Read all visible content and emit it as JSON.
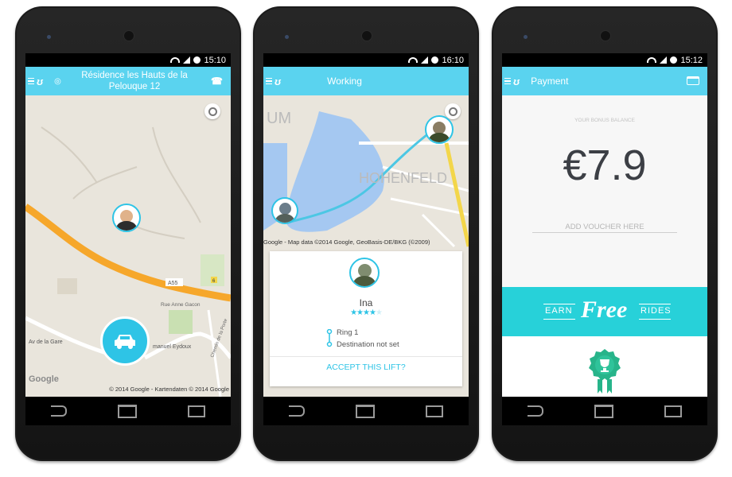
{
  "phones": [
    {
      "status_time": "15:10",
      "header_title": "Résidence les Hauts de la Pelouque 12",
      "map_copyright": "© 2014 Google - Kartendaten © 2014 Google",
      "map_logo": "Google",
      "road_label": "A55",
      "road_number": "6",
      "street_labels": [
        "Rue Anne Gacon",
        "Av de la Gare",
        "manuel Eydoux",
        "Chemin de la Porte"
      ]
    },
    {
      "status_time": "16:10",
      "header_title": "Working",
      "map_copyright": "Google - Map data ©2014 Google, GeoBasis-DE/BKG (©2009)",
      "map_label_1": "UM",
      "map_label_2": "HOHENFELD",
      "card": {
        "name": "Ina",
        "rating": 4,
        "rating_max": 5,
        "pickup": "Ring 1",
        "destination": "Destination not set",
        "accept_label": "ACCEPT THIS LIFT?"
      }
    },
    {
      "status_time": "15:12",
      "header_title": "Payment",
      "bonus_label": "YOUR BONUS BALANCE",
      "balance": "€7.9",
      "voucher_placeholder": "ADD VOUCHER HERE",
      "banner": {
        "earn": "EARN",
        "free": "Free",
        "rides": "RIDES"
      }
    }
  ],
  "colors": {
    "accent": "#5ad3ef",
    "teal": "#27d1d9",
    "star": "#2ec4e6",
    "map_bg": "#e9e5dc",
    "road": "#f6a72b"
  }
}
